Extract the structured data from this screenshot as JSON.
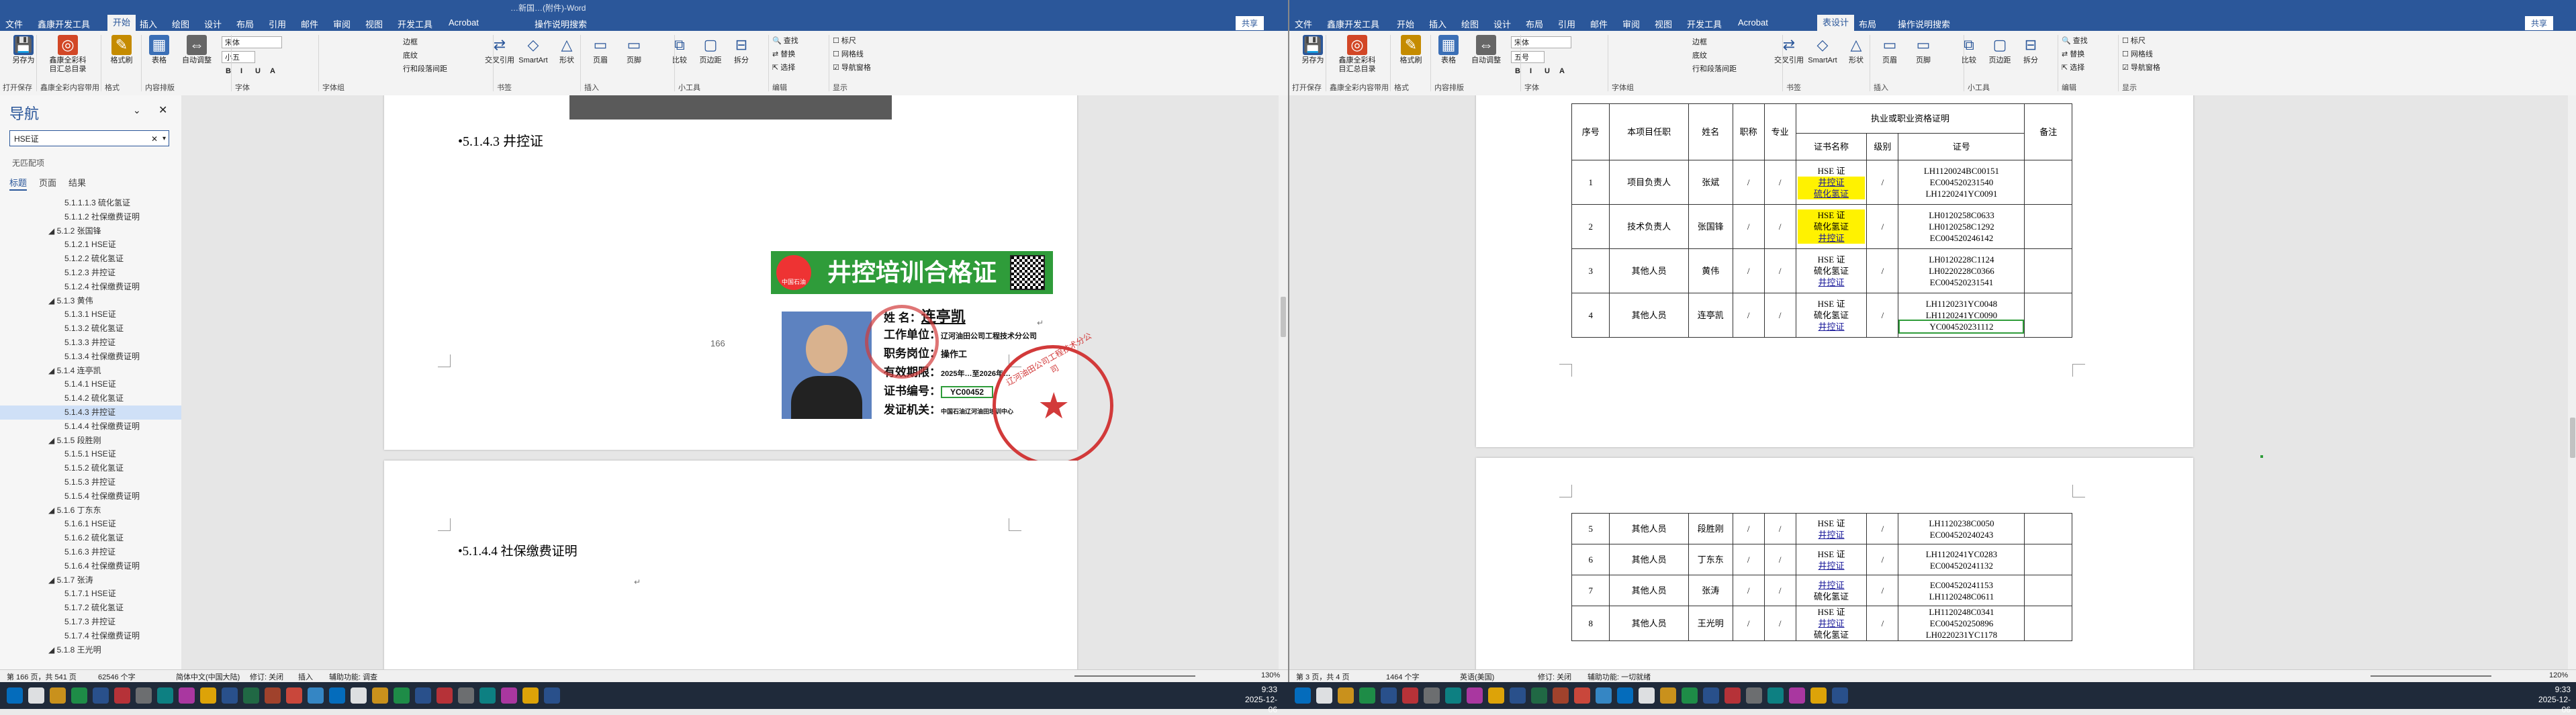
{
  "left": {
    "title": "…新国…(附件)-Word",
    "tabs": [
      "文件",
      "鑫康开发工具",
      "开始",
      "插入",
      "绘图",
      "设计",
      "布局",
      "引用",
      "邮件",
      "审阅",
      "视图",
      "开发工具",
      "Acrobat"
    ],
    "active_tab": "开始",
    "tell_me": "操作说明搜索",
    "share": "共享",
    "ribbon": {
      "buttons": [
        {
          "label": "另存为",
          "icon": "save-icon"
        },
        {
          "label": "鑫康全彩科目汇总目录",
          "icon": "color-wheel-icon"
        },
        {
          "label": "格式刷",
          "icon": "brush-icon"
        },
        {
          "label": "表格",
          "icon": "table-icon"
        },
        {
          "label": "自动调整",
          "icon": "autofit-icon"
        }
      ],
      "font_name": "宋体",
      "font_size": "小五",
      "groups": [
        "打开保存",
        "鑫康全彩内容带用",
        "格式",
        "内容排版",
        "字体",
        "字体组",
        "书签",
        "插入",
        "小工具",
        "编辑",
        "显示"
      ],
      "extra_labels": [
        "边框",
        "底纹",
        "行和段落间距"
      ],
      "insert_buttons": [
        "交叉引用",
        "SmartArt",
        "形状",
        "页眉",
        "页脚"
      ],
      "tools": [
        "比较",
        "页边距",
        "拆分"
      ],
      "edit": [
        "查找",
        "替换",
        "选择"
      ],
      "view": [
        "标尺",
        "网格线",
        "导航窗格"
      ]
    },
    "nav": {
      "title": "导航",
      "search": "HSE证",
      "note": "无匹配项",
      "tabs": [
        "标题",
        "页面",
        "结果"
      ],
      "items": [
        {
          "t": "5.1.1.1.3 硫化氢证",
          "l": 3
        },
        {
          "t": "5.1.1.2 社保缴费证明",
          "l": 3
        },
        {
          "t": "5.1.2 张国锋",
          "l": 2
        },
        {
          "t": "5.1.2.1 HSE证",
          "l": 3
        },
        {
          "t": "5.1.2.2 硫化氢证",
          "l": 3
        },
        {
          "t": "5.1.2.3 井控证",
          "l": 3
        },
        {
          "t": "5.1.2.4 社保缴费证明",
          "l": 3
        },
        {
          "t": "5.1.3 黄伟",
          "l": 2
        },
        {
          "t": "5.1.3.1 HSE证",
          "l": 3
        },
        {
          "t": "5.1.3.2 硫化氢证",
          "l": 3
        },
        {
          "t": "5.1.3.3 井控证",
          "l": 3
        },
        {
          "t": "5.1.3.4 社保缴费证明",
          "l": 3
        },
        {
          "t": "5.1.4 连亭凯",
          "l": 2
        },
        {
          "t": "5.1.4.1 HSE证",
          "l": 3
        },
        {
          "t": "5.1.4.2 硫化氢证",
          "l": 3
        },
        {
          "t": "5.1.4.3 井控证",
          "l": 3,
          "sel": true
        },
        {
          "t": "5.1.4.4 社保缴费证明",
          "l": 3
        },
        {
          "t": "5.1.5 段胜刚",
          "l": 2
        },
        {
          "t": "5.1.5.1 HSE证",
          "l": 3
        },
        {
          "t": "5.1.5.2 硫化氢证",
          "l": 3
        },
        {
          "t": "5.1.5.3 井控证",
          "l": 3
        },
        {
          "t": "5.1.5.4 社保缴费证明",
          "l": 3
        },
        {
          "t": "5.1.6 丁东东",
          "l": 2
        },
        {
          "t": "5.1.6.1 HSE证",
          "l": 3
        },
        {
          "t": "5.1.6.2 硫化氢证",
          "l": 3
        },
        {
          "t": "5.1.6.3 井控证",
          "l": 3
        },
        {
          "t": "5.1.6.4 社保缴费证明",
          "l": 3
        },
        {
          "t": "5.1.7 张涛",
          "l": 2
        },
        {
          "t": "5.1.7.1 HSE证",
          "l": 3
        },
        {
          "t": "5.1.7.2 硫化氢证",
          "l": 3
        },
        {
          "t": "5.1.7.3 井控证",
          "l": 3
        },
        {
          "t": "5.1.7.4 社保缴费证明",
          "l": 3
        },
        {
          "t": "5.1.8 王光明",
          "l": 2
        }
      ]
    },
    "doc": {
      "heading1": "•5.1.4.3  井控证",
      "page_no": "166",
      "heading2": "•5.1.4.4  社保缴费证明",
      "cert": {
        "title": "井控培训合格证",
        "logo": "中国石油",
        "name_label": "姓    名：",
        "name": "连亭凯",
        "employer_label": "工作单位：",
        "employer": "辽河油田公司工程技术分公司",
        "position_label": "职务岗位：",
        "position": "操作工",
        "valid_label": "有效期限：",
        "valid": "2025年…至2026年…",
        "certno_label": "证书编号：",
        "certno": "YC00452",
        "issuer_label": "发证机关：",
        "issuer": "中国石油辽河油田培训中心",
        "stamp_text": "辽河油田公司工程技术分公司"
      }
    },
    "status": {
      "page": "第 166 页，共 541 页",
      "words": "62546 个字",
      "lang": "简体中文(中国大陆)",
      "track": "修订: 关闭",
      "insert": "插入",
      "access": "辅助功能: 调查",
      "zoom": "130%"
    }
  },
  "right": {
    "tabs": [
      "文件",
      "鑫康开发工具",
      "开始",
      "插入",
      "绘图",
      "设计",
      "布局",
      "引用",
      "邮件",
      "审阅",
      "视图",
      "开发工具",
      "Acrobat",
      "表设计",
      "布局"
    ],
    "active_tab": "表设计",
    "tell_me": "操作说明搜索",
    "share": "共享",
    "font_name": "宋体",
    "font_size": "五号",
    "table": {
      "headers": [
        "序号",
        "本项目任职",
        "姓名",
        "职称",
        "专业",
        "执业或职业资格证明",
        "备注"
      ],
      "subheaders": [
        "证书名称",
        "级别",
        "证号"
      ],
      "rows_top": [
        {
          "no": "1",
          "role": "项目负责人",
          "name": "张斌",
          "certs": [
            "HSE 证",
            "井控证",
            "硫化氢证"
          ],
          "ids": [
            "LH1120024BC00151",
            "EC004520231540",
            "LH1220241YC0091"
          ]
        },
        {
          "no": "2",
          "role": "技术负责人",
          "name": "张国锋",
          "certs": [
            "HSE 证",
            "硫化氢证",
            "井控证"
          ],
          "ids": [
            "LH0120258C0633",
            "LH0120258C1292",
            "EC004520246142"
          ]
        },
        {
          "no": "3",
          "role": "其他人员",
          "name": "黄伟",
          "certs": [
            "HSE 证",
            "硫化氢证",
            "井控证"
          ],
          "ids": [
            "LH0120228C1124",
            "LH0220228C0366",
            "EC004520231541"
          ]
        },
        {
          "no": "4",
          "role": "其他人员",
          "name": "连亭凯",
          "certs": [
            "HSE 证",
            "硫化氢证",
            "井控证"
          ],
          "ids": [
            "LH1120231YC0048",
            "LH1120241YC0090",
            "YC004520231112"
          ]
        }
      ],
      "rows_bottom": [
        {
          "no": "5",
          "role": "其他人员",
          "name": "段胜刚",
          "certs": [
            "HSE 证",
            "井控证"
          ],
          "ids": [
            "LH1120238C0050",
            "EC004520240243"
          ]
        },
        {
          "no": "6",
          "role": "其他人员",
          "name": "丁东东",
          "certs": [
            "HSE 证",
            "井控证"
          ],
          "ids": [
            "LH1120241YC0283",
            "EC004520241132"
          ]
        },
        {
          "no": "7",
          "role": "其他人员",
          "name": "张涛",
          "certs": [
            "井控证",
            "硫化氢证"
          ],
          "ids": [
            "EC004520241153",
            "LH1120248C0611"
          ]
        },
        {
          "no": "8",
          "role": "其他人员",
          "name": "王光明",
          "certs": [
            "HSE 证",
            "井控证",
            "硫化氢证"
          ],
          "ids": [
            "LH1120248C0341",
            "EC004520250896",
            "LH0220231YC1178"
          ]
        }
      ],
      "slash": "/"
    },
    "status": {
      "page": "第 3 页，共 4 页",
      "words": "1464 个字",
      "lang": "英语(美国)",
      "track": "修订: 关闭",
      "access": "辅助功能: 一切就绪",
      "zoom": "120%"
    }
  },
  "taskbar": {
    "time_left": "9:33",
    "date_left": "2025-12-06",
    "time_right": "9:33",
    "date_right": "2025-12-06"
  }
}
